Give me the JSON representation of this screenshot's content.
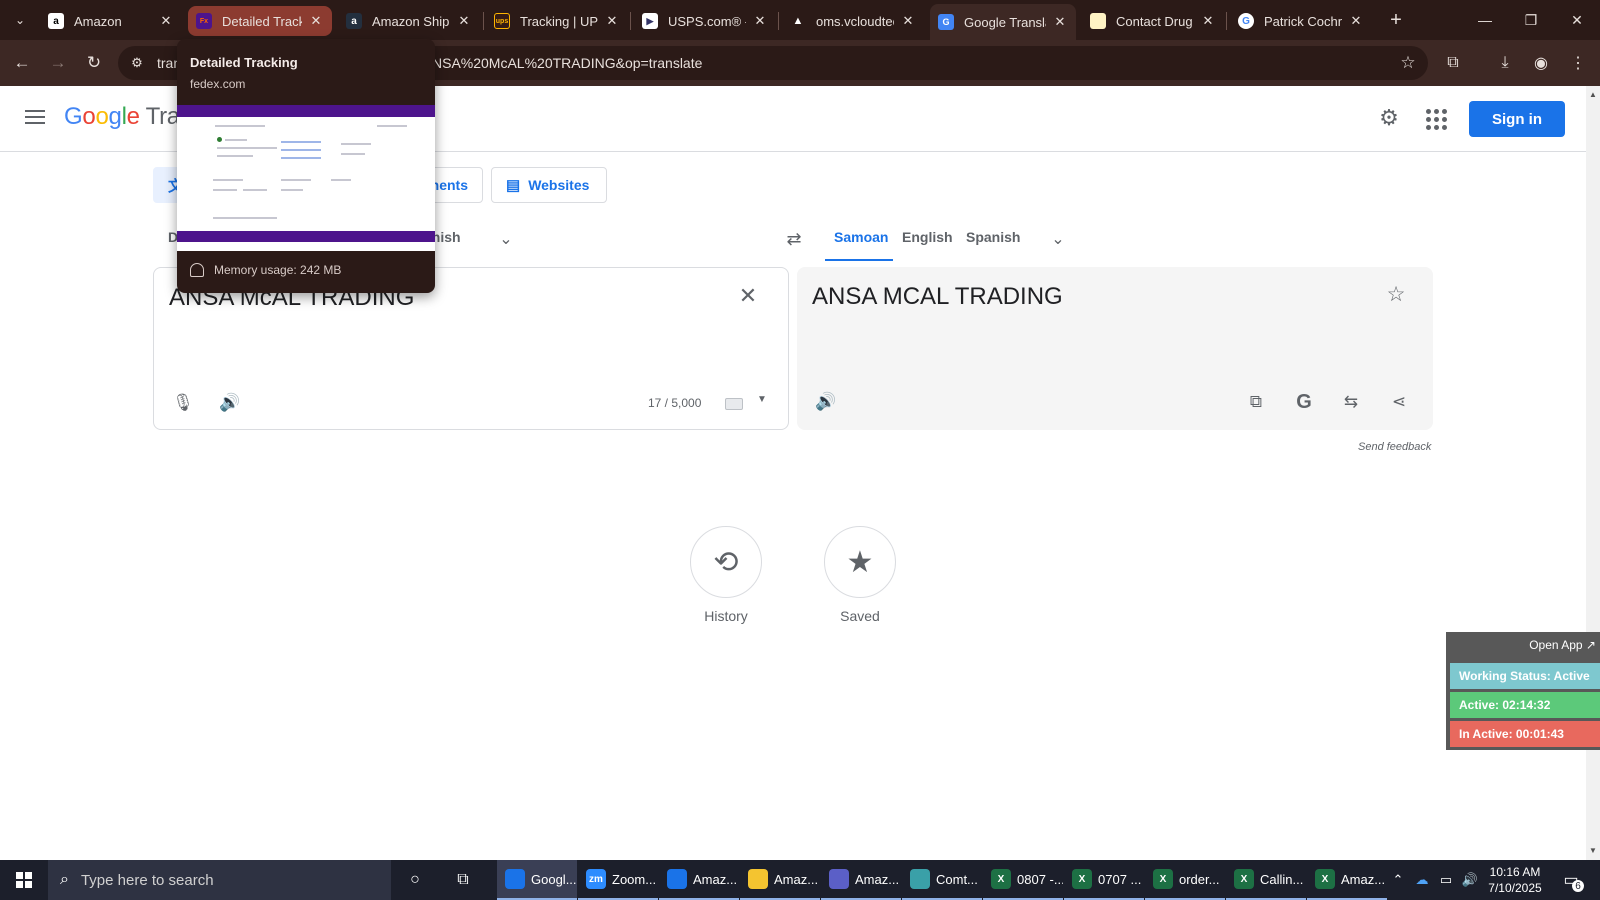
{
  "browser": {
    "tabs": [
      {
        "title": "Amazon",
        "icon": "amazon-icon"
      },
      {
        "title": "Detailed Tracking",
        "icon": "fedex-icon"
      },
      {
        "title": "Amazon Shipping",
        "icon": "amazon-icon"
      },
      {
        "title": "Tracking | UPS",
        "icon": "ups-icon"
      },
      {
        "title": "USPS.com® - USPS",
        "icon": "usps-icon"
      },
      {
        "title": "oms.vcloudtech",
        "icon": "triangle-icon"
      },
      {
        "title": "Google Translate",
        "icon": "google-translate-icon"
      },
      {
        "title": "Contact Drug Info",
        "icon": "bookmark-icon"
      },
      {
        "title": "Patrick Cochran",
        "icon": "google-icon"
      }
    ],
    "url_prefix": "tran",
    "url_suffix": "NSA%20McAL%20TRADING&op=translate"
  },
  "preview": {
    "title": "Detailed Tracking",
    "domain": "fedex.com",
    "memory": "Memory usage: 242 MB"
  },
  "translate": {
    "logo_g": [
      "G",
      "o",
      "o",
      "g",
      "l",
      "e"
    ],
    "logo_rest": "Tran",
    "sign_in": "Sign in",
    "modes": {
      "documents": "nents",
      "websites": "Websites"
    },
    "source_langs": {
      "detect_partial": "D",
      "spanish_partial": "anish"
    },
    "target_langs": [
      "Samoan",
      "English",
      "Spanish"
    ],
    "source_text": "ANSA McAL TRADING",
    "target_text": "ANSA MCAL TRADING",
    "char_count": "17 / 5,000",
    "send_feedback": "Send feedback",
    "history_label": "History",
    "saved_label": "Saved"
  },
  "widget": {
    "open_app": "Open App ↗",
    "working_status": "Working Status: Active",
    "active": "Active: 02:14:32",
    "inactive": "In Active: 00:01:43",
    "colors": {
      "status": "#7ec8cf",
      "active": "#5cc97a",
      "inactive": "#e8695e"
    }
  },
  "taskbar": {
    "search_placeholder": "Type here to search",
    "apps": [
      {
        "label": "Googl...",
        "icon": "chrome-icon",
        "color": "#1a73e8"
      },
      {
        "label": "Zoom...",
        "icon": "zoom-icon",
        "color": "#2d8cff"
      },
      {
        "label": "Amaz...",
        "icon": "chrome-icon",
        "color": "#1a73e8"
      },
      {
        "label": "Amaz...",
        "icon": "folder-icon",
        "color": "#f4c430"
      },
      {
        "label": "Amaz...",
        "icon": "teams-icon",
        "color": "#5b5fc7"
      },
      {
        "label": "Comt...",
        "icon": "app-icon",
        "color": "#3aa0a8"
      },
      {
        "label": "0807 -...",
        "icon": "excel-icon",
        "color": "#1d7044"
      },
      {
        "label": "0707 ...",
        "icon": "excel-icon",
        "color": "#1d7044"
      },
      {
        "label": "order...",
        "icon": "excel-icon",
        "color": "#1d7044"
      },
      {
        "label": "Callin...",
        "icon": "excel-icon",
        "color": "#1d7044"
      },
      {
        "label": "Amaz...",
        "icon": "excel-icon",
        "color": "#1d7044"
      }
    ],
    "time": "10:16 AM",
    "date": "7/10/2025",
    "notifications": "6"
  }
}
